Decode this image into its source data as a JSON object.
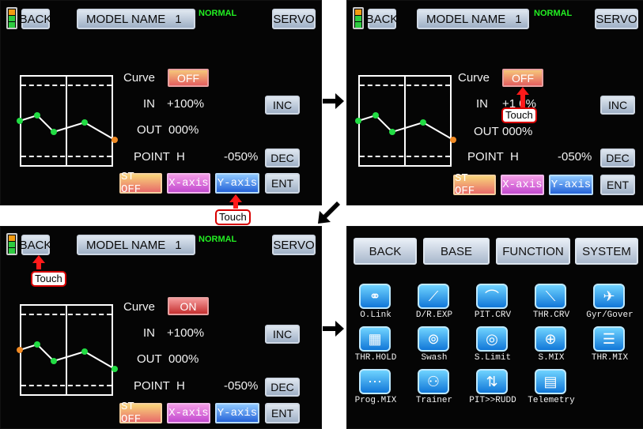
{
  "header": {
    "back_label": "BACK",
    "model_label": "MODEL NAME",
    "model_number": "1",
    "mode_label": "NORMAL",
    "servo_label": "SERVO"
  },
  "curve_screen": {
    "curve_label": "Curve",
    "in_label": "IN",
    "in_value": "+100%",
    "out_label": "OUT",
    "out_value": "000%",
    "point_label": "POINT",
    "point_id": "H",
    "point_value": "-050%",
    "inc_label": "INC",
    "dec_label": "DEC",
    "ent_label": "ENT",
    "st_off_label": "ST OFF",
    "x_axis_label": "X-axis",
    "y_axis_label": "Y-axis"
  },
  "panel1": {
    "curve_state": "OFF"
  },
  "panel2": {
    "curve_state": "OFF",
    "in_value_partial": "+1 0%",
    "touch_label": "Touch"
  },
  "panel3": {
    "curve_state": "ON",
    "touch_label": "Touch"
  },
  "touch_between": "Touch",
  "menu": {
    "tabs": [
      "BACK",
      "BASE",
      "FUNCTION",
      "SYSTEM"
    ],
    "items": [
      {
        "label": "O.Link",
        "icon": "link-icon"
      },
      {
        "label": "D/R.EXP",
        "icon": "curve-icon"
      },
      {
        "label": "PIT.CRV",
        "icon": "pitch-curve-icon"
      },
      {
        "label": "THR.CRV",
        "icon": "throttle-curve-icon"
      },
      {
        "label": "Gyr/Gover",
        "icon": "gyro-icon"
      },
      {
        "label": "THR.HOLD",
        "icon": "throttle-hold-icon"
      },
      {
        "label": "Swash",
        "icon": "swash-icon"
      },
      {
        "label": "S.Limit",
        "icon": "swash-limit-icon"
      },
      {
        "label": "S.MIX",
        "icon": "swash-mix-icon"
      },
      {
        "label": "THR.MIX",
        "icon": "throttle-mix-icon"
      },
      {
        "label": "Prog.MIX",
        "icon": "program-mix-icon"
      },
      {
        "label": "Trainer",
        "icon": "trainer-icon"
      },
      {
        "label": "PIT>>RUDD",
        "icon": "pitch-rudder-icon"
      },
      {
        "label": "Telemetry",
        "icon": "telemetry-icon"
      }
    ]
  },
  "colors": {
    "accent_red": "#ff1a1a",
    "mode_green": "#22ee22",
    "icon_blue": "#1177d8"
  }
}
